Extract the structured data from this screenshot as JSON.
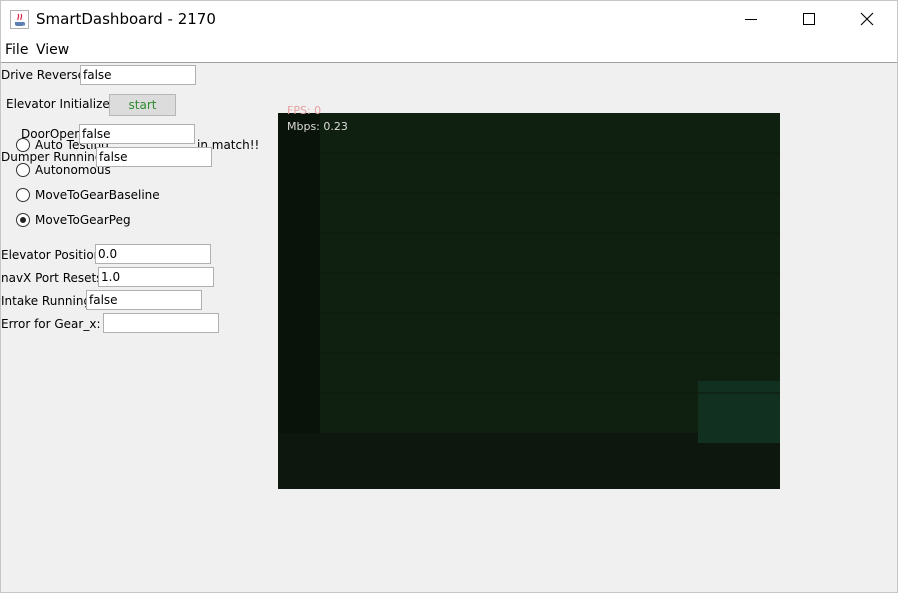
{
  "window": {
    "title": "SmartDashboard - 2170"
  },
  "menu": {
    "file": "File",
    "view": "View"
  },
  "widgets": {
    "drive_reverse": {
      "label": "Drive Reverse",
      "value": "false"
    },
    "elevator_initialize": {
      "label": "Elevator Initialize",
      "button": "start"
    },
    "door_open": {
      "label": "DoorOpen",
      "value": "false"
    },
    "dumper_running": {
      "label": "Dumper Running",
      "value": "false"
    },
    "auto_chooser": {
      "overlap_text": "Auto Testing",
      "overlap_text_tail": "in match!!",
      "options": [
        "Autonomous",
        "MoveToGearBaseline",
        "MoveToGearPeg"
      ],
      "selected": "MoveToGearPeg"
    },
    "elevator_position": {
      "label": "Elevator Position",
      "value": "0.0"
    },
    "navx_port_resets": {
      "label": "navX Port Resets",
      "value": "1.0"
    },
    "intake_running": {
      "label": "Intake Running",
      "value": "false"
    },
    "error_gear_x": {
      "label": "Error for Gear_x:",
      "value": ""
    }
  },
  "camera": {
    "fps": "FPS: 0",
    "mbps": "Mbps: 0.23"
  }
}
